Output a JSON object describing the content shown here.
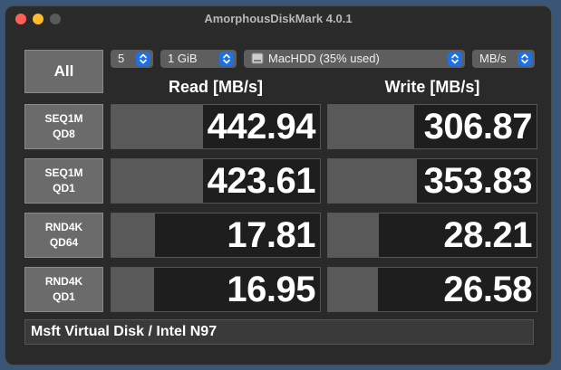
{
  "window": {
    "title": "AmorphousDiskMark 4.0.1"
  },
  "controls": {
    "all_label": "All",
    "count": "5",
    "size": "1 GiB",
    "drive": "MacHDD (35% used)",
    "unit": "MB/s"
  },
  "columns": {
    "read": "Read [MB/s]",
    "write": "Write [MB/s]"
  },
  "tests": [
    {
      "line1": "SEQ1M",
      "line2": "QD8",
      "read": "442.94",
      "write": "306.87",
      "read_value": 442.94,
      "write_value": 306.87
    },
    {
      "line1": "SEQ1M",
      "line2": "QD1",
      "read": "423.61",
      "write": "353.83",
      "read_value": 423.61,
      "write_value": 353.83
    },
    {
      "line1": "RND4K",
      "line2": "QD64",
      "read": "17.81",
      "write": "28.21",
      "read_value": 17.81,
      "write_value": 28.21
    },
    {
      "line1": "RND4K",
      "line2": "QD1",
      "read": "16.95",
      "write": "26.58",
      "read_value": 16.95,
      "write_value": 26.58
    }
  ],
  "footer": {
    "device": "Msft Virtual Disk / Intel N97"
  },
  "icons": {
    "close": "close-button-icon",
    "minimize": "minimize-button-icon",
    "zoom": "zoom-button-icon",
    "drive": "hard-drive-icon",
    "stepper": "up-down-chevron-icon"
  },
  "colors": {
    "close": "#ff5f57",
    "minimize": "#febc2e",
    "stepper": "#1f6fe5"
  }
}
